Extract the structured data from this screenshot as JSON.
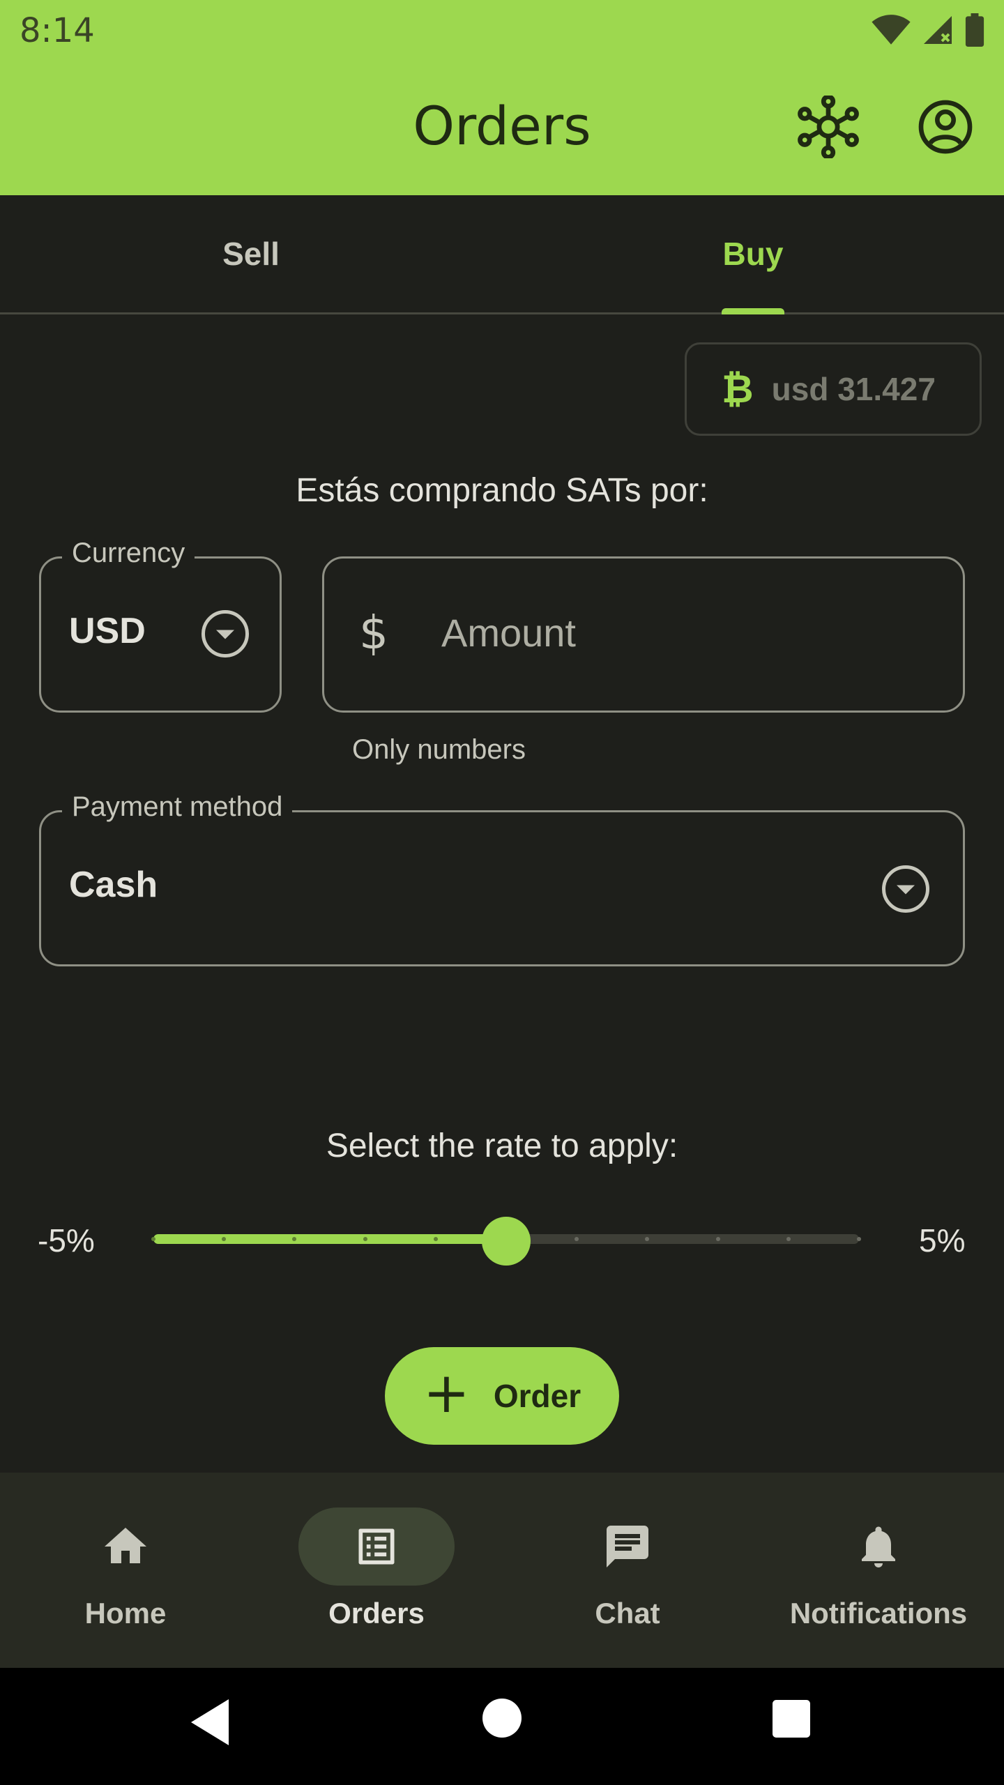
{
  "status_bar": {
    "time": "8:14",
    "icons": [
      "wifi-icon",
      "signal-icon",
      "battery-icon"
    ]
  },
  "app_bar": {
    "title": "Orders",
    "actions": [
      "relays-network-icon",
      "account-circle-icon"
    ]
  },
  "tabs": [
    {
      "label": "Sell",
      "selected": false
    },
    {
      "label": "Buy",
      "selected": true
    }
  ],
  "price": {
    "symbol": "₿",
    "value": "usd 31.427"
  },
  "form": {
    "subtitle": "Estás comprando SATs por:",
    "currency": {
      "label": "Currency",
      "value": "USD"
    },
    "amount": {
      "prefix": "$",
      "placeholder": "Amount",
      "helper": "Only numbers"
    },
    "payment": {
      "label": "Payment method",
      "value": "Cash"
    }
  },
  "rate": {
    "label": "Select the rate to apply:",
    "min_label": "-5%",
    "max_label": "5%",
    "min": -5,
    "max": 5,
    "steps": 10,
    "value": 0
  },
  "fab": {
    "label": "Order"
  },
  "bottom_nav": [
    {
      "label": "Home",
      "icon": "home-icon",
      "active": false
    },
    {
      "label": "Orders",
      "icon": "list-icon",
      "active": true
    },
    {
      "label": "Chat",
      "icon": "chat-icon",
      "active": false
    },
    {
      "label": "Notifications",
      "icon": "bell-icon",
      "active": false
    }
  ],
  "colors": {
    "accent": "#9dd84f",
    "background": "#1e1f1b",
    "nav_bar": "#282a22",
    "on_accent": "#1f2a12"
  }
}
